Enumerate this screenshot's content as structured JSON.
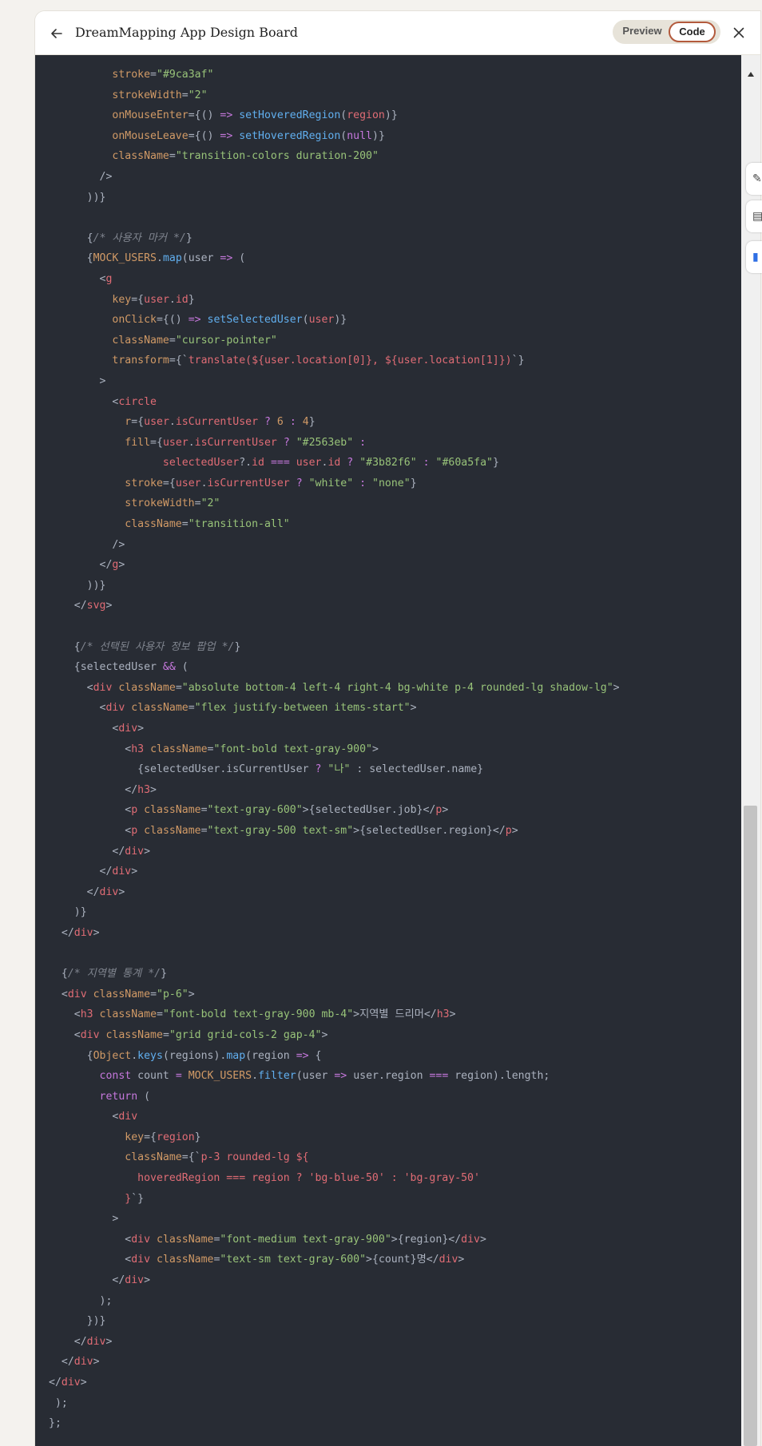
{
  "header": {
    "title": "DreamMapping App Design Board",
    "preview_label": "Preview",
    "code_label": "Code"
  },
  "icons": {
    "back": "arrow-left-icon",
    "close": "close-icon",
    "scroll_up": "chevron-up-icon"
  },
  "colors": {
    "editor_bg": "#282c34",
    "keyword": "#c678dd",
    "tag": "#e06c75",
    "string": "#98c379",
    "attr": "#d19a66",
    "function": "#61afef",
    "comment": "#7f848e",
    "accent": "#b35a3c"
  },
  "code_lines": [
    [
      [
        "          ",
        "p"
      ],
      [
        "stroke",
        "a"
      ],
      [
        "=",
        "p"
      ],
      [
        "\"#9ca3af\"",
        "s"
      ]
    ],
    [
      [
        "          ",
        "p"
      ],
      [
        "strokeWidth",
        "a"
      ],
      [
        "=",
        "p"
      ],
      [
        "\"2\"",
        "s"
      ]
    ],
    [
      [
        "          ",
        "p"
      ],
      [
        "onMouseEnter",
        "a"
      ],
      [
        "={() ",
        "p"
      ],
      [
        "=>",
        "k"
      ],
      [
        " ",
        "p"
      ],
      [
        "setHoveredRegion",
        "f"
      ],
      [
        "(",
        "p"
      ],
      [
        "region",
        "t"
      ],
      [
        ")}",
        "p"
      ]
    ],
    [
      [
        "          ",
        "p"
      ],
      [
        "onMouseLeave",
        "a"
      ],
      [
        "={() ",
        "p"
      ],
      [
        "=>",
        "k"
      ],
      [
        " ",
        "p"
      ],
      [
        "setHoveredRegion",
        "f"
      ],
      [
        "(",
        "p"
      ],
      [
        "null",
        "k"
      ],
      [
        ")}",
        "p"
      ]
    ],
    [
      [
        "          ",
        "p"
      ],
      [
        "className",
        "a"
      ],
      [
        "=",
        "p"
      ],
      [
        "\"transition-colors duration-200\"",
        "s"
      ]
    ],
    [
      [
        "        />",
        "p"
      ]
    ],
    [
      [
        "      ))}",
        "p"
      ]
    ],
    [
      [
        "",
        "p"
      ]
    ],
    [
      [
        "      {",
        "p"
      ],
      [
        "/* 사용자 마커 */",
        "c"
      ],
      [
        "}",
        "p"
      ]
    ],
    [
      [
        "      {",
        "p"
      ],
      [
        "MOCK_USERS",
        "a"
      ],
      [
        ".",
        "p"
      ],
      [
        "map",
        "f"
      ],
      [
        "(user ",
        "p"
      ],
      [
        "=>",
        "k"
      ],
      [
        " (",
        "p"
      ]
    ],
    [
      [
        "        <",
        "p"
      ],
      [
        "g",
        "t"
      ]
    ],
    [
      [
        "          ",
        "p"
      ],
      [
        "key",
        "a"
      ],
      [
        "={",
        "p"
      ],
      [
        "user",
        "t"
      ],
      [
        ".",
        "p"
      ],
      [
        "id",
        "t"
      ],
      [
        "}",
        "p"
      ]
    ],
    [
      [
        "          ",
        "p"
      ],
      [
        "onClick",
        "a"
      ],
      [
        "={() ",
        "p"
      ],
      [
        "=>",
        "k"
      ],
      [
        " ",
        "p"
      ],
      [
        "setSelectedUser",
        "f"
      ],
      [
        "(",
        "p"
      ],
      [
        "user",
        "t"
      ],
      [
        ")}",
        "p"
      ]
    ],
    [
      [
        "          ",
        "p"
      ],
      [
        "className",
        "a"
      ],
      [
        "=",
        "p"
      ],
      [
        "\"cursor-pointer\"",
        "s"
      ]
    ],
    [
      [
        "          ",
        "p"
      ],
      [
        "transform",
        "a"
      ],
      [
        "={`",
        "p"
      ],
      [
        "translate(${user.location[0]}, ${user.location[1]})",
        "t"
      ],
      [
        "`}",
        "p"
      ]
    ],
    [
      [
        "        >",
        "p"
      ]
    ],
    [
      [
        "          <",
        "p"
      ],
      [
        "circle",
        "t"
      ]
    ],
    [
      [
        "            ",
        "p"
      ],
      [
        "r",
        "a"
      ],
      [
        "={",
        "p"
      ],
      [
        "user",
        "t"
      ],
      [
        ".",
        "p"
      ],
      [
        "isCurrentUser",
        "t"
      ],
      [
        " ",
        "p"
      ],
      [
        "?",
        "k"
      ],
      [
        " ",
        "p"
      ],
      [
        "6",
        "a"
      ],
      [
        " ",
        "p"
      ],
      [
        ":",
        "k"
      ],
      [
        " ",
        "p"
      ],
      [
        "4",
        "a"
      ],
      [
        "}",
        "p"
      ]
    ],
    [
      [
        "            ",
        "p"
      ],
      [
        "fill",
        "a"
      ],
      [
        "={",
        "p"
      ],
      [
        "user",
        "t"
      ],
      [
        ".",
        "p"
      ],
      [
        "isCurrentUser",
        "t"
      ],
      [
        " ",
        "p"
      ],
      [
        "?",
        "k"
      ],
      [
        " ",
        "p"
      ],
      [
        "\"#2563eb\"",
        "s"
      ],
      [
        " ",
        "p"
      ],
      [
        ":",
        "k"
      ]
    ],
    [
      [
        "                  ",
        "p"
      ],
      [
        "selectedUser",
        "t"
      ],
      [
        "?.",
        "p"
      ],
      [
        "id",
        "t"
      ],
      [
        " ",
        "p"
      ],
      [
        "===",
        "k"
      ],
      [
        " ",
        "p"
      ],
      [
        "user",
        "t"
      ],
      [
        ".",
        "p"
      ],
      [
        "id",
        "t"
      ],
      [
        " ",
        "p"
      ],
      [
        "?",
        "k"
      ],
      [
        " ",
        "p"
      ],
      [
        "\"#3b82f6\"",
        "s"
      ],
      [
        " ",
        "p"
      ],
      [
        ":",
        "k"
      ],
      [
        " ",
        "p"
      ],
      [
        "\"#60a5fa\"",
        "s"
      ],
      [
        "}",
        "p"
      ]
    ],
    [
      [
        "            ",
        "p"
      ],
      [
        "stroke",
        "a"
      ],
      [
        "={",
        "p"
      ],
      [
        "user",
        "t"
      ],
      [
        ".",
        "p"
      ],
      [
        "isCurrentUser",
        "t"
      ],
      [
        " ",
        "p"
      ],
      [
        "?",
        "k"
      ],
      [
        " ",
        "p"
      ],
      [
        "\"white\"",
        "s"
      ],
      [
        " ",
        "p"
      ],
      [
        ":",
        "k"
      ],
      [
        " ",
        "p"
      ],
      [
        "\"none\"",
        "s"
      ],
      [
        "}",
        "p"
      ]
    ],
    [
      [
        "            ",
        "p"
      ],
      [
        "strokeWidth",
        "a"
      ],
      [
        "=",
        "p"
      ],
      [
        "\"2\"",
        "s"
      ]
    ],
    [
      [
        "            ",
        "p"
      ],
      [
        "className",
        "a"
      ],
      [
        "=",
        "p"
      ],
      [
        "\"transition-all\"",
        "s"
      ]
    ],
    [
      [
        "          />",
        "p"
      ]
    ],
    [
      [
        "        </",
        "p"
      ],
      [
        "g",
        "t"
      ],
      [
        ">",
        "p"
      ]
    ],
    [
      [
        "      ))}",
        "p"
      ]
    ],
    [
      [
        "    </",
        "p"
      ],
      [
        "svg",
        "t"
      ],
      [
        ">",
        "p"
      ]
    ],
    [
      [
        "",
        "p"
      ]
    ],
    [
      [
        "    {",
        "p"
      ],
      [
        "/* 선택된 사용자 정보 팝업 */",
        "c"
      ],
      [
        "}",
        "p"
      ]
    ],
    [
      [
        "    {selectedUser ",
        "p"
      ],
      [
        "&&",
        "k"
      ],
      [
        " (",
        "p"
      ]
    ],
    [
      [
        "      <",
        "p"
      ],
      [
        "div",
        "t"
      ],
      [
        " ",
        "p"
      ],
      [
        "className",
        "a"
      ],
      [
        "=",
        "p"
      ],
      [
        "\"absolute bottom-4 left-4 right-4 bg-white p-4 rounded-lg shadow-lg\"",
        "s"
      ],
      [
        ">",
        "p"
      ]
    ],
    [
      [
        "        <",
        "p"
      ],
      [
        "div",
        "t"
      ],
      [
        " ",
        "p"
      ],
      [
        "className",
        "a"
      ],
      [
        "=",
        "p"
      ],
      [
        "\"flex justify-between items-start\"",
        "s"
      ],
      [
        ">",
        "p"
      ]
    ],
    [
      [
        "          <",
        "p"
      ],
      [
        "div",
        "t"
      ],
      [
        ">",
        "p"
      ]
    ],
    [
      [
        "            <",
        "p"
      ],
      [
        "h3",
        "t"
      ],
      [
        " ",
        "p"
      ],
      [
        "className",
        "a"
      ],
      [
        "=",
        "p"
      ],
      [
        "\"font-bold text-gray-900\"",
        "s"
      ],
      [
        ">",
        "p"
      ]
    ],
    [
      [
        "              {selectedUser.isCurrentUser ",
        "p"
      ],
      [
        "?",
        "k"
      ],
      [
        " ",
        "p"
      ],
      [
        "\"나\"",
        "s"
      ],
      [
        " : selectedUser.name}",
        "p"
      ]
    ],
    [
      [
        "            </",
        "p"
      ],
      [
        "h3",
        "t"
      ],
      [
        ">",
        "p"
      ]
    ],
    [
      [
        "            <",
        "p"
      ],
      [
        "p",
        "t"
      ],
      [
        " ",
        "p"
      ],
      [
        "className",
        "a"
      ],
      [
        "=",
        "p"
      ],
      [
        "\"text-gray-600\"",
        "s"
      ],
      [
        ">{selectedUser.job}</",
        "p"
      ],
      [
        "p",
        "t"
      ],
      [
        ">",
        "p"
      ]
    ],
    [
      [
        "            <",
        "p"
      ],
      [
        "p",
        "t"
      ],
      [
        " ",
        "p"
      ],
      [
        "className",
        "a"
      ],
      [
        "=",
        "p"
      ],
      [
        "\"text-gray-500 text-sm\"",
        "s"
      ],
      [
        ">{selectedUser.region}</",
        "p"
      ],
      [
        "p",
        "t"
      ],
      [
        ">",
        "p"
      ]
    ],
    [
      [
        "          </",
        "p"
      ],
      [
        "div",
        "t"
      ],
      [
        ">",
        "p"
      ]
    ],
    [
      [
        "        </",
        "p"
      ],
      [
        "div",
        "t"
      ],
      [
        ">",
        "p"
      ]
    ],
    [
      [
        "      </",
        "p"
      ],
      [
        "div",
        "t"
      ],
      [
        ">",
        "p"
      ]
    ],
    [
      [
        "    )}",
        "p"
      ]
    ],
    [
      [
        "  </",
        "p"
      ],
      [
        "div",
        "t"
      ],
      [
        ">",
        "p"
      ]
    ],
    [
      [
        "",
        "p"
      ]
    ],
    [
      [
        "  {",
        "p"
      ],
      [
        "/* 지역별 통계 */",
        "c"
      ],
      [
        "}",
        "p"
      ]
    ],
    [
      [
        "  <",
        "p"
      ],
      [
        "div",
        "t"
      ],
      [
        " ",
        "p"
      ],
      [
        "className",
        "a"
      ],
      [
        "=",
        "p"
      ],
      [
        "\"p-6\"",
        "s"
      ],
      [
        ">",
        "p"
      ]
    ],
    [
      [
        "    <",
        "p"
      ],
      [
        "h3",
        "t"
      ],
      [
        " ",
        "p"
      ],
      [
        "className",
        "a"
      ],
      [
        "=",
        "p"
      ],
      [
        "\"font-bold text-gray-900 mb-4\"",
        "s"
      ],
      [
        ">지역별 드리머</",
        "p"
      ],
      [
        "h3",
        "t"
      ],
      [
        ">",
        "p"
      ]
    ],
    [
      [
        "    <",
        "p"
      ],
      [
        "div",
        "t"
      ],
      [
        " ",
        "p"
      ],
      [
        "className",
        "a"
      ],
      [
        "=",
        "p"
      ],
      [
        "\"grid grid-cols-2 gap-4\"",
        "s"
      ],
      [
        ">",
        "p"
      ]
    ],
    [
      [
        "      {",
        "p"
      ],
      [
        "Object",
        "a"
      ],
      [
        ".",
        "p"
      ],
      [
        "keys",
        "f"
      ],
      [
        "(regions).",
        "p"
      ],
      [
        "map",
        "f"
      ],
      [
        "(region ",
        "p"
      ],
      [
        "=>",
        "k"
      ],
      [
        " {",
        "p"
      ]
    ],
    [
      [
        "        ",
        "p"
      ],
      [
        "const",
        "k"
      ],
      [
        " count ",
        "p"
      ],
      [
        "=",
        "k"
      ],
      [
        " ",
        "p"
      ],
      [
        "MOCK_USERS",
        "a"
      ],
      [
        ".",
        "p"
      ],
      [
        "filter",
        "f"
      ],
      [
        "(user ",
        "p"
      ],
      [
        "=>",
        "k"
      ],
      [
        " user.region ",
        "p"
      ],
      [
        "===",
        "k"
      ],
      [
        " region).length;",
        "p"
      ]
    ],
    [
      [
        "        ",
        "p"
      ],
      [
        "return",
        "k"
      ],
      [
        " (",
        "p"
      ]
    ],
    [
      [
        "          <",
        "p"
      ],
      [
        "div",
        "t"
      ]
    ],
    [
      [
        "            ",
        "p"
      ],
      [
        "key",
        "a"
      ],
      [
        "={",
        "p"
      ],
      [
        "region",
        "t"
      ],
      [
        "}",
        "p"
      ]
    ],
    [
      [
        "            ",
        "p"
      ],
      [
        "className",
        "a"
      ],
      [
        "={`",
        "p"
      ],
      [
        "p-3 rounded-lg ${",
        "t"
      ]
    ],
    [
      [
        "              ",
        "p"
      ],
      [
        "hoveredRegion === region ? 'bg-blue-50' : 'bg-gray-50'",
        "t"
      ]
    ],
    [
      [
        "            ",
        "p"
      ],
      [
        "}",
        "t"
      ],
      [
        "`}",
        "p"
      ]
    ],
    [
      [
        "          >",
        "p"
      ]
    ],
    [
      [
        "            <",
        "p"
      ],
      [
        "div",
        "t"
      ],
      [
        " ",
        "p"
      ],
      [
        "className",
        "a"
      ],
      [
        "=",
        "p"
      ],
      [
        "\"font-medium text-gray-900\"",
        "s"
      ],
      [
        ">{region}</",
        "p"
      ],
      [
        "div",
        "t"
      ],
      [
        ">",
        "p"
      ]
    ],
    [
      [
        "            <",
        "p"
      ],
      [
        "div",
        "t"
      ],
      [
        " ",
        "p"
      ],
      [
        "className",
        "a"
      ],
      [
        "=",
        "p"
      ],
      [
        "\"text-sm text-gray-600\"",
        "s"
      ],
      [
        ">{count}명</",
        "p"
      ],
      [
        "div",
        "t"
      ],
      [
        ">",
        "p"
      ]
    ],
    [
      [
        "          </",
        "p"
      ],
      [
        "div",
        "t"
      ],
      [
        ">",
        "p"
      ]
    ],
    [
      [
        "        );",
        "p"
      ]
    ],
    [
      [
        "      })}",
        "p"
      ]
    ],
    [
      [
        "    </",
        "p"
      ],
      [
        "div",
        "t"
      ],
      [
        ">",
        "p"
      ]
    ],
    [
      [
        "  </",
        "p"
      ],
      [
        "div",
        "t"
      ],
      [
        ">",
        "p"
      ]
    ],
    [
      [
        "</",
        "p"
      ],
      [
        "div",
        "t"
      ],
      [
        ">",
        "p"
      ]
    ],
    [
      [
        " );",
        "p"
      ]
    ],
    [
      [
        "};",
        "p"
      ]
    ]
  ]
}
